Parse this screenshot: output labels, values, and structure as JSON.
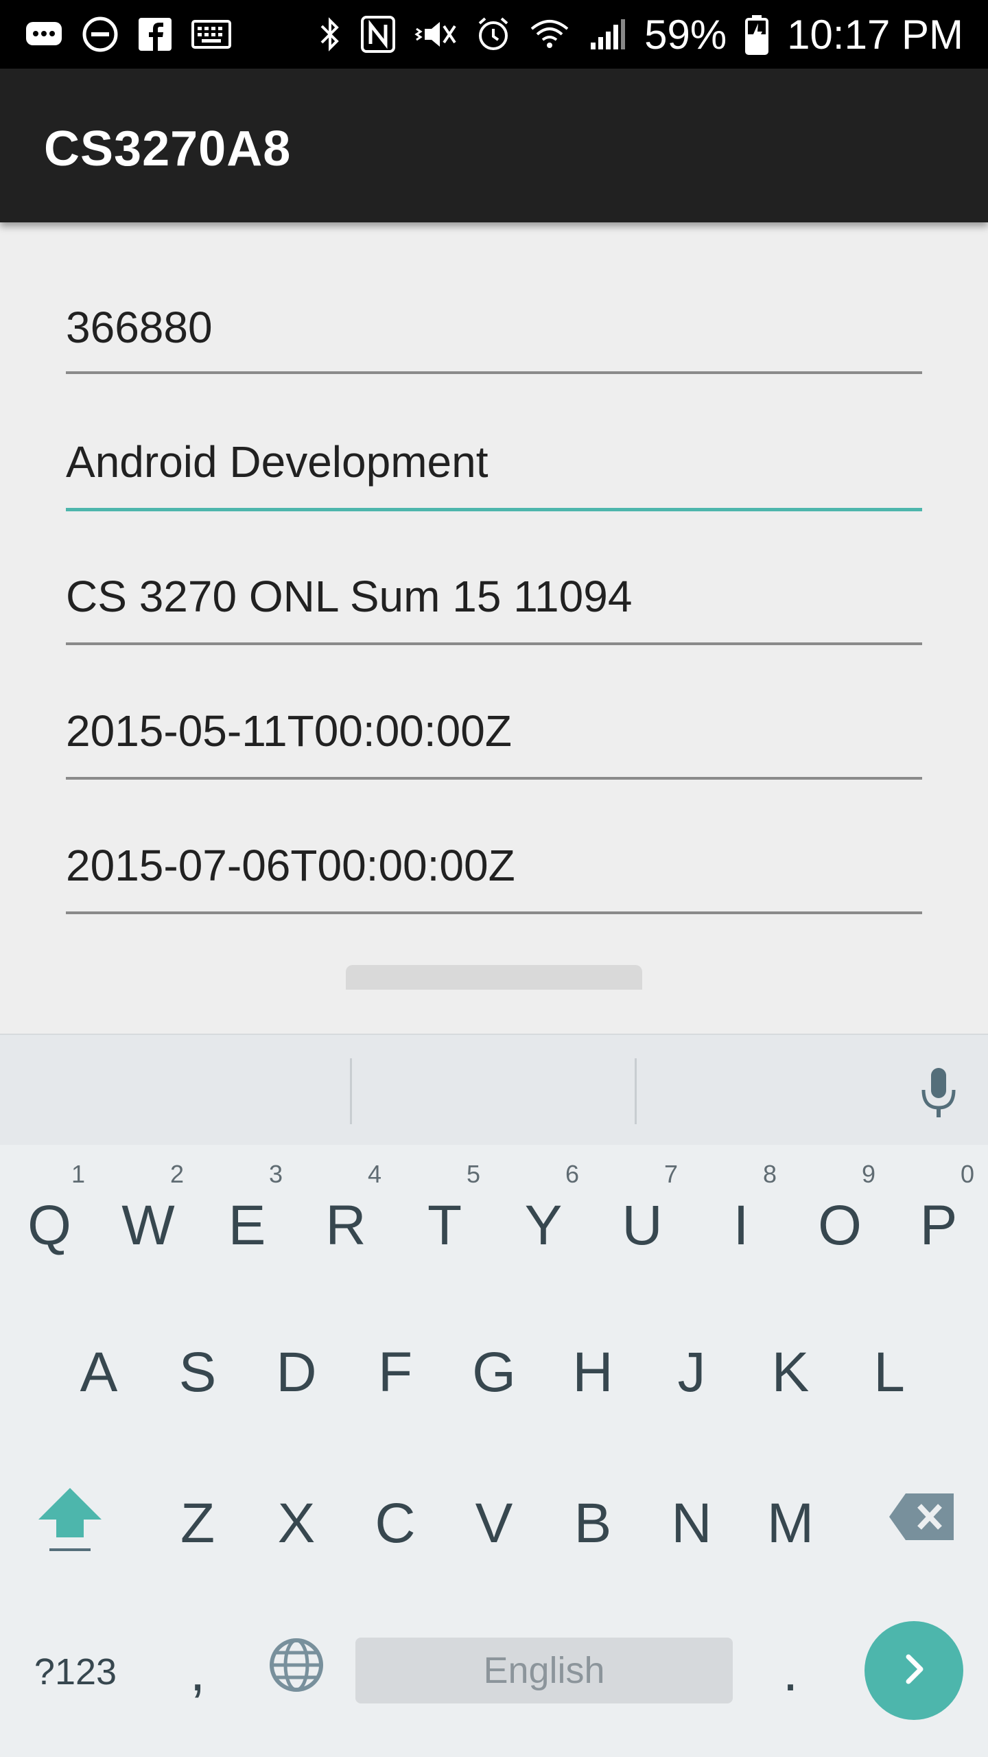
{
  "status_bar": {
    "battery": "59%",
    "time": "10:17 PM",
    "left_icons": [
      "messenger-icon",
      "do-not-disturb-icon",
      "facebook-icon",
      "keyboard-icon"
    ],
    "right_icons": [
      "bluetooth-icon",
      "nfc-icon",
      "vibrate-icon",
      "alarm-icon",
      "wifi-icon",
      "signal-icon",
      "battery-charging-icon"
    ]
  },
  "app_bar": {
    "title": "CS3270A8"
  },
  "form": {
    "fields": [
      {
        "value": "366880"
      },
      {
        "value": "Android Development",
        "focused": true
      },
      {
        "value": "CS 3270 ONL Sum 15 11094"
      },
      {
        "value": "2015-05-11T00:00:00Z"
      },
      {
        "value": "2015-07-06T00:00:00Z"
      }
    ]
  },
  "colors": {
    "accent": "#4db6ac",
    "app_bar": "#212121",
    "status_bar": "#000000",
    "keyboard_bg": "#eceff1",
    "key_text": "#37474f"
  },
  "keyboard": {
    "row1": [
      {
        "key": "Q",
        "hint": "1"
      },
      {
        "key": "W",
        "hint": "2"
      },
      {
        "key": "E",
        "hint": "3"
      },
      {
        "key": "R",
        "hint": "4"
      },
      {
        "key": "T",
        "hint": "5"
      },
      {
        "key": "Y",
        "hint": "6"
      },
      {
        "key": "U",
        "hint": "7"
      },
      {
        "key": "I",
        "hint": "8"
      },
      {
        "key": "O",
        "hint": "9"
      },
      {
        "key": "P",
        "hint": "0"
      }
    ],
    "row2": [
      "A",
      "S",
      "D",
      "F",
      "G",
      "H",
      "J",
      "K",
      "L"
    ],
    "row3": [
      "Z",
      "X",
      "C",
      "V",
      "B",
      "N",
      "M"
    ],
    "symbols_label": "?123",
    "comma": ",",
    "period": ".",
    "space_label": "English"
  }
}
